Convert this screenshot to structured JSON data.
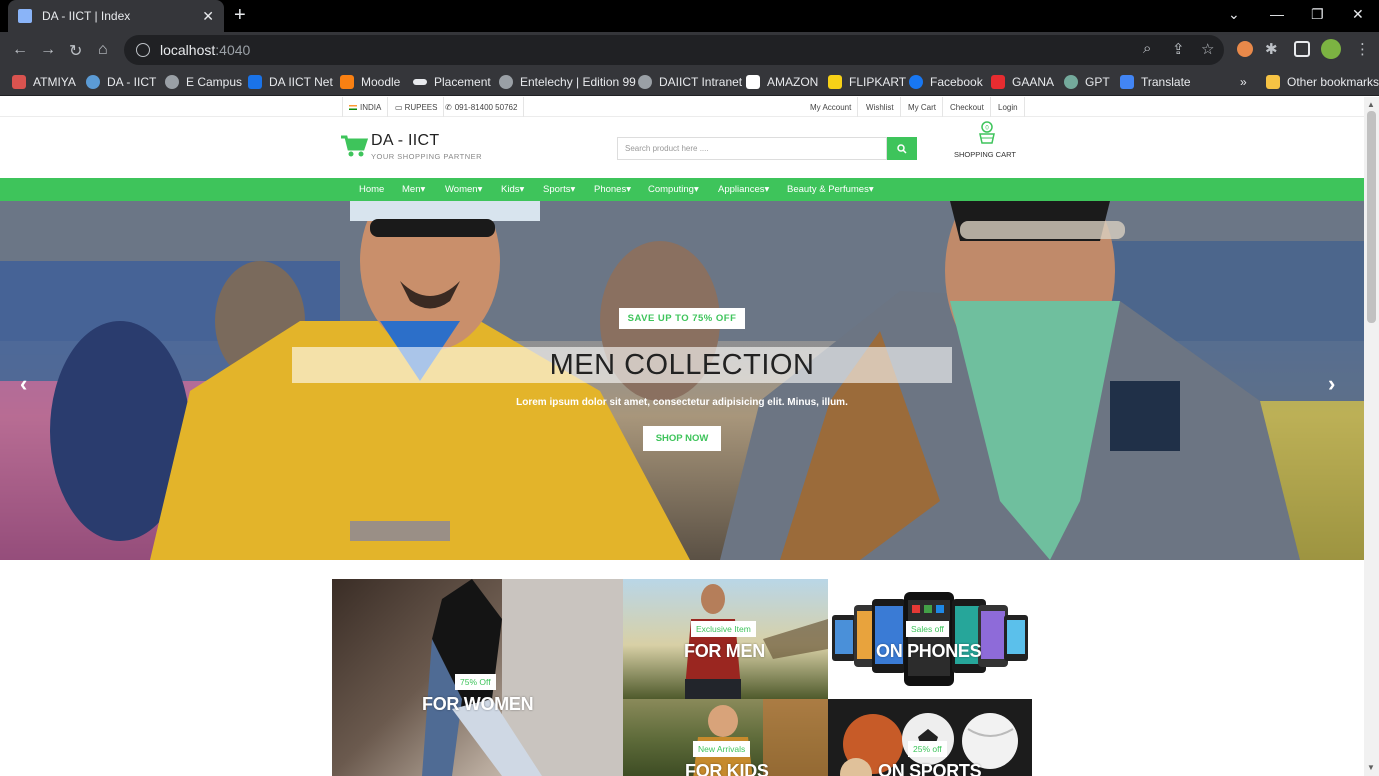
{
  "browser": {
    "tab_title": "DA - IICT | Index",
    "url_host": "localhost",
    "url_port": ":4040",
    "bookmarks": [
      "ATMIYA",
      "DA - IICT",
      "E Campus",
      "DA IICT Net",
      "Moodle",
      "Placement",
      "Entelechy | Edition 99",
      "DAIICT Intranet",
      "AMAZON",
      "FLIPKART",
      "Facebook",
      "GAANA",
      "GPT",
      "Translate"
    ],
    "other_bookmarks": "Other bookmarks",
    "more_bookmarks": "»"
  },
  "topbar": {
    "country": "INDIA",
    "currency": "RUPEES",
    "phone": "091-81400 50762",
    "links": [
      "My Account",
      "Wishlist",
      "My Cart",
      "Checkout",
      "Login"
    ]
  },
  "header": {
    "logo_title": "DA - IICT",
    "logo_subtitle": "YOUR SHOPPING PARTNER",
    "search_placeholder": "Search product here ....",
    "cart_label": "SHOPPING CART"
  },
  "nav": [
    "Home",
    "Men",
    "Women",
    "Kids",
    "Sports",
    "Phones",
    "Computing",
    "Appliances",
    "Beauty & Perfumes"
  ],
  "hero": {
    "badge": "SAVE UP TO 75% OFF",
    "title": "MEN COLLECTION",
    "description": "Lorem ipsum dolor sit amet, consectetur adipisicing elit. Minus, illum.",
    "button": "SHOP NOW"
  },
  "tiles": [
    {
      "badge": "75% Off",
      "label": "FOR WOMEN"
    },
    {
      "badge": "Exclusive Item",
      "label": "FOR MEN"
    },
    {
      "badge": "Sales off",
      "label": "ON PHONES"
    },
    {
      "badge": "New Arrivals",
      "label": "FOR KIDS"
    },
    {
      "badge": "25% off",
      "label": "ON SPORTS"
    }
  ],
  "colors": {
    "accent": "#3ec45b",
    "chrome_dark": "#35363a"
  }
}
